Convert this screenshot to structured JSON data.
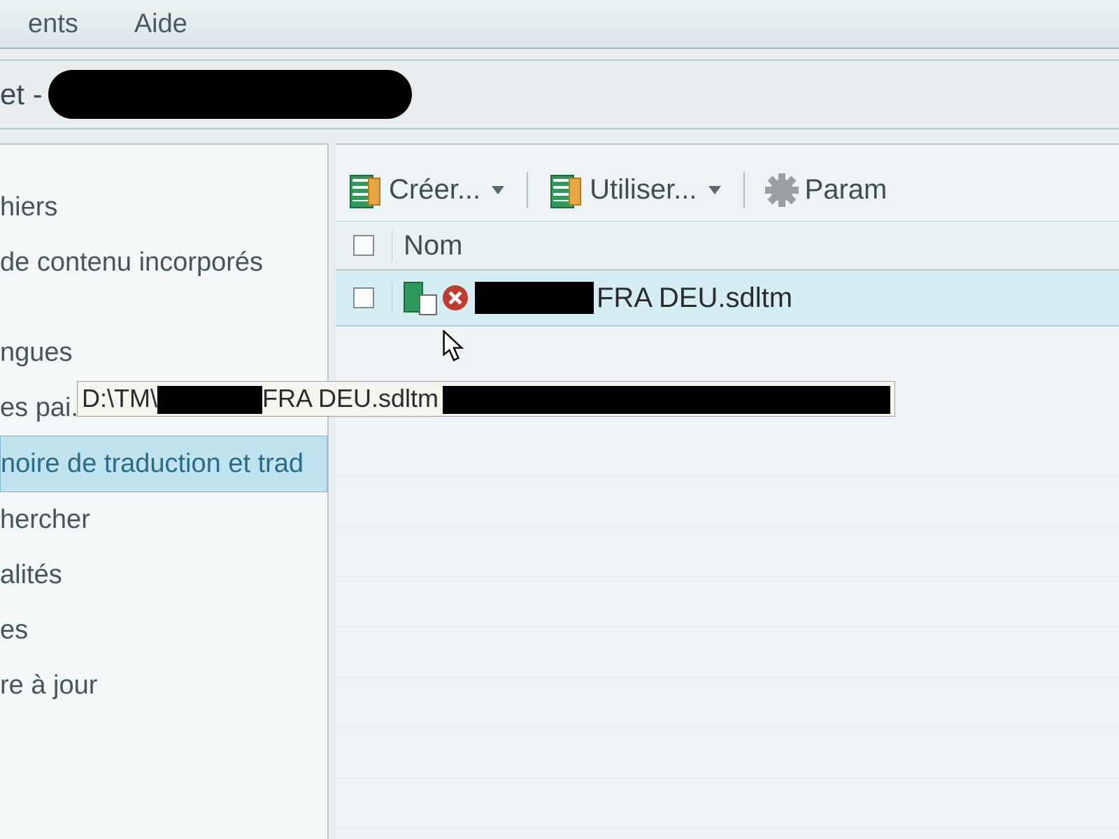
{
  "menu": {
    "item1": "ents",
    "item2": "Aide"
  },
  "title": {
    "prefix": "et - "
  },
  "sidebar": {
    "items": [
      "hiers",
      " de contenu incorporés",
      "ngues",
      "es pai...",
      "noire de traduction et trad",
      "hercher",
      "alités",
      "es",
      "re à jour"
    ]
  },
  "tooltip": {
    "prefix": "D:\\TM\\",
    "suffix": "FRA DEU.sdltm"
  },
  "toolbar": {
    "create": "Créer...",
    "use": "Utiliser...",
    "params": "Param"
  },
  "table": {
    "header_name": "Nom",
    "row1_filename": "FRA DEU.sdltm"
  }
}
